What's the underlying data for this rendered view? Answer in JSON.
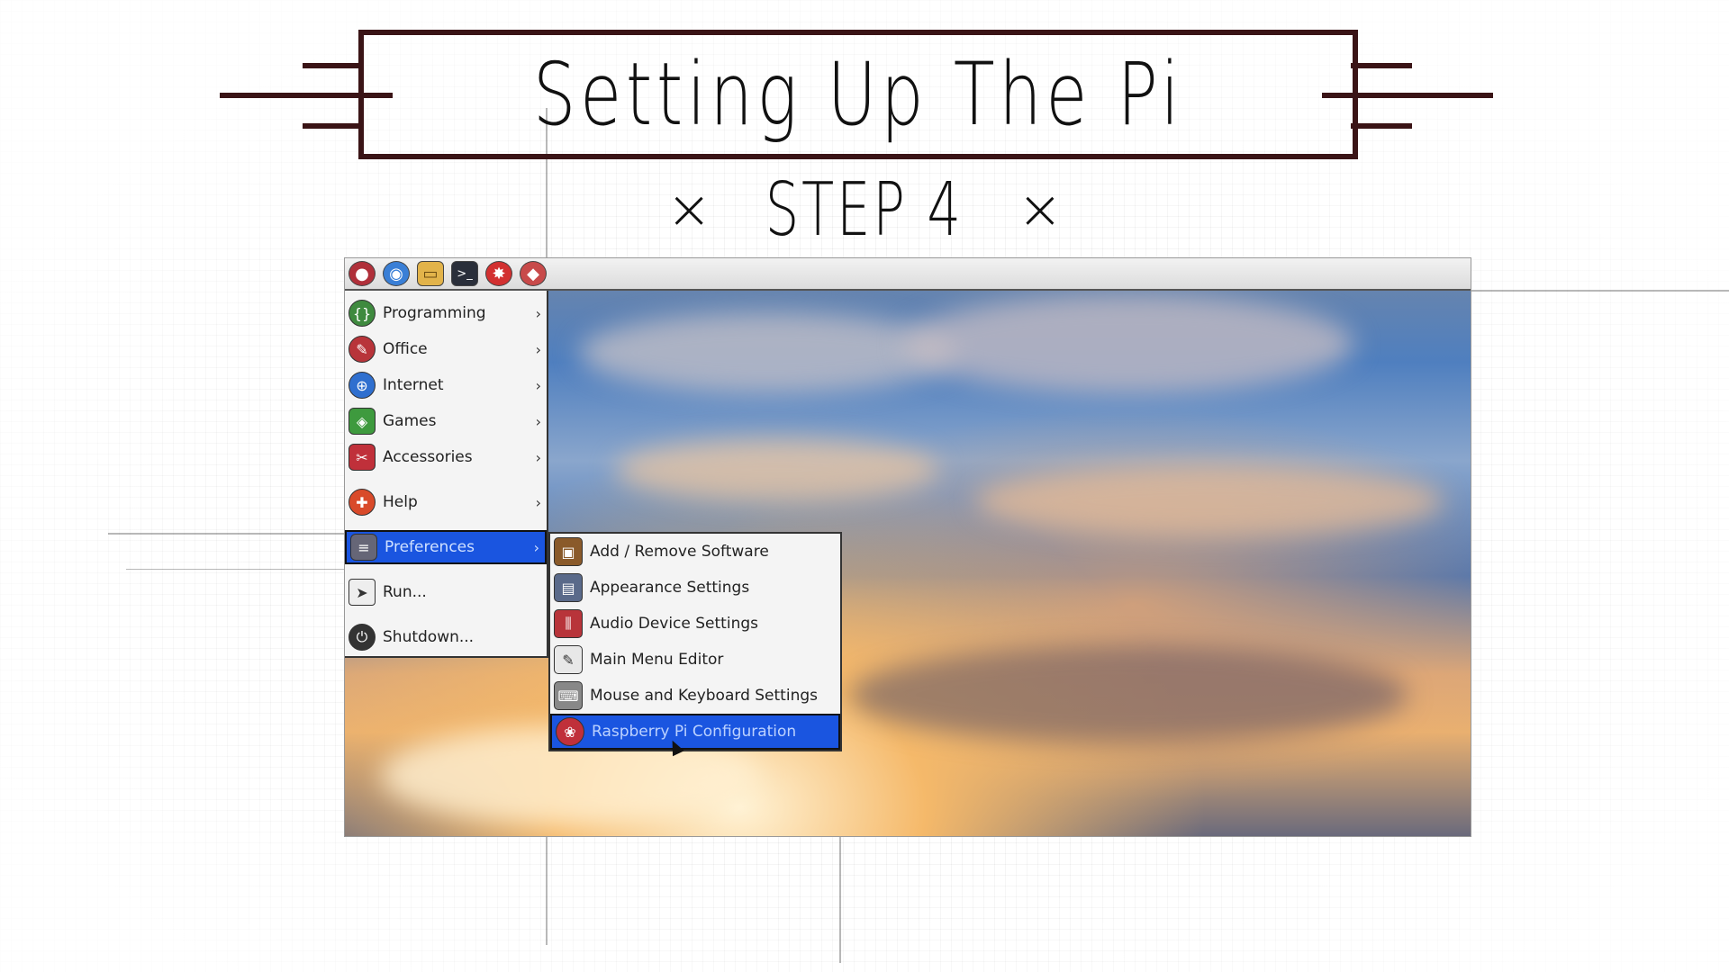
{
  "title": "Setting Up The Pi",
  "step": {
    "left_mark": "×",
    "label": "STEP 4",
    "right_mark": "×"
  },
  "taskbar": {
    "icons": [
      {
        "name": "raspberry-menu-icon",
        "glyph": "●"
      },
      {
        "name": "web-browser-icon",
        "glyph": "◉"
      },
      {
        "name": "file-manager-icon",
        "glyph": "▭"
      },
      {
        "name": "terminal-icon",
        "glyph": ">_"
      },
      {
        "name": "mathematica-icon",
        "glyph": "✸"
      },
      {
        "name": "wolfram-icon",
        "glyph": "◆"
      }
    ]
  },
  "menu": {
    "items": [
      {
        "label": "Programming",
        "icon": "programming-icon",
        "has_submenu": true
      },
      {
        "label": "Office",
        "icon": "office-icon",
        "has_submenu": true
      },
      {
        "label": "Internet",
        "icon": "internet-icon",
        "has_submenu": true
      },
      {
        "label": "Games",
        "icon": "games-icon",
        "has_submenu": true
      },
      {
        "label": "Accessories",
        "icon": "accessories-icon",
        "has_submenu": true
      },
      {
        "label": "Help",
        "icon": "help-icon",
        "has_submenu": true
      },
      {
        "label": "Preferences",
        "icon": "preferences-icon",
        "has_submenu": true,
        "active": true
      },
      {
        "label": "Run...",
        "icon": "run-icon",
        "has_submenu": false
      },
      {
        "label": "Shutdown...",
        "icon": "shutdown-icon",
        "has_submenu": false
      }
    ],
    "arrow": "›"
  },
  "submenu": {
    "items": [
      {
        "label": "Add / Remove Software",
        "icon": "package-icon"
      },
      {
        "label": "Appearance Settings",
        "icon": "appearance-icon"
      },
      {
        "label": "Audio Device Settings",
        "icon": "audio-mixer-icon"
      },
      {
        "label": "Main Menu Editor",
        "icon": "menu-editor-icon"
      },
      {
        "label": "Mouse and Keyboard Settings",
        "icon": "mouse-keyboard-icon"
      },
      {
        "label": "Raspberry Pi Configuration",
        "icon": "raspberry-pi-icon",
        "active": true
      }
    ]
  },
  "colors": {
    "banner": "#3a1416",
    "highlight": "#1a55e0"
  }
}
